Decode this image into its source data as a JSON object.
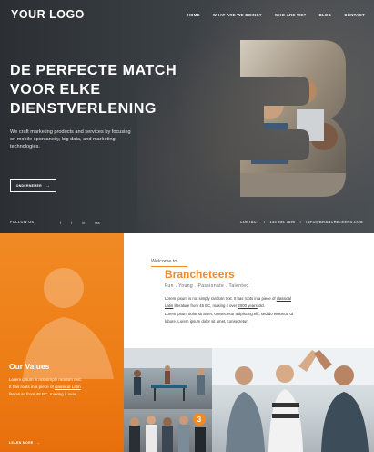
{
  "header": {
    "logo": "YOUR LOGO",
    "nav": [
      "HOME",
      "WHAT ARE WE DOING?",
      "WHO ARE WE?",
      "BLOG",
      "CONTACT"
    ]
  },
  "hero": {
    "title": "DE PERFECTE MATCH VOOR ELKE DIENSTVERLENING",
    "intro": "We craft marketing products and services by focusing on mobile spontaneity, big data, and marketing technologies.",
    "button_label": "ONDERNEMER",
    "button_arrow": "→"
  },
  "footer_bar": {
    "follow": "FOLLOW US",
    "socials": [
      "f",
      "t",
      "in",
      "rss"
    ],
    "contact_label": "CONTACT",
    "phone": "133 456 7890",
    "email": "INFO@BRANCHETEERS.COM",
    "separator": "•"
  },
  "values": {
    "title": "Our Values",
    "text_line1": "Lorem ipsum is not simply random text.",
    "text_line2a": "It has roots in a piece of ",
    "text_line2_link": "classical Latin",
    "text_line3": "literature from 45 BC, making it over.",
    "learn_more": "LEARN MORE",
    "learn_arrow": "→"
  },
  "welcome": {
    "small": "Welcome to",
    "brand": "Brancheteers",
    "tagline": "Fun . Young . Passionate . Talented",
    "p1a": "Lorem ipsum is not simply random text. It has roots in a piece of ",
    "p1_link1": "classical",
    "p2_link": "Latin",
    "p2b": " literature from 45 BC, making it over ",
    "p2_link2": "2000 years",
    "p2c": " old.",
    "p3": "Lorem ipsum dolor sit amet, consectetur adipiscing elit, sed do eiusmod ut",
    "p4": "labore. Lorem ipsum dolor sit amet, consectetur."
  },
  "badge": "3",
  "colors": {
    "accent": "#f08a24",
    "hero_bg": "#33383d"
  }
}
